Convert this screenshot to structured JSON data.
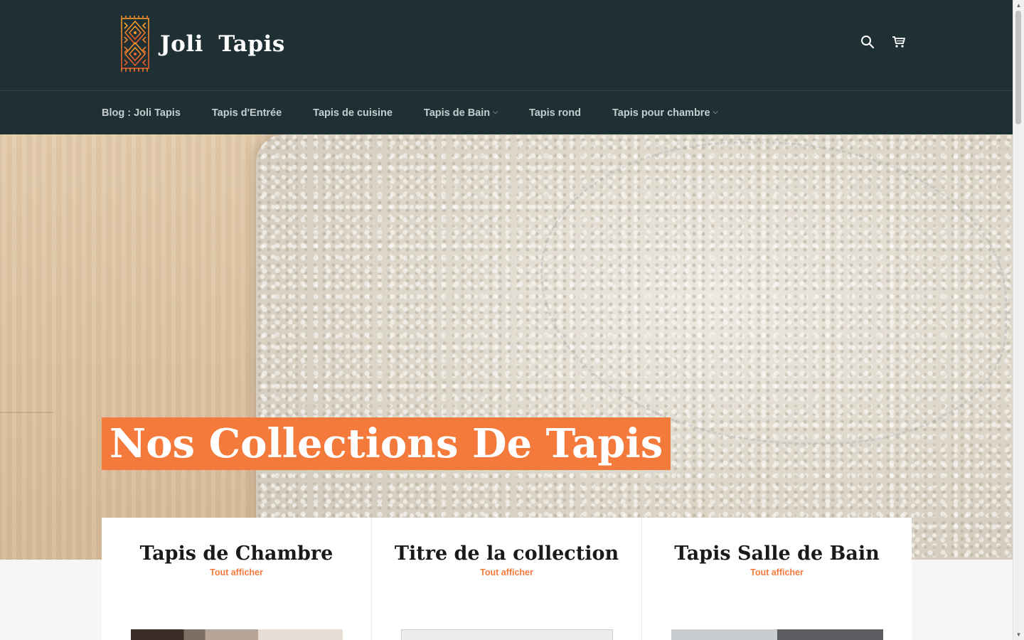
{
  "header": {
    "logo_text": "Joli  Tapis",
    "icons": [
      "search-icon",
      "cart-icon"
    ]
  },
  "nav": {
    "items": [
      {
        "label": "Blog : Joli Tapis",
        "dropdown": false
      },
      {
        "label": "Tapis d'Entrée",
        "dropdown": false
      },
      {
        "label": "Tapis de cuisine",
        "dropdown": false
      },
      {
        "label": "Tapis de Bain",
        "dropdown": true
      },
      {
        "label": "Tapis rond",
        "dropdown": false
      },
      {
        "label": "Tapis pour chambre",
        "dropdown": true
      }
    ]
  },
  "hero": {
    "title": "Nos Collections De Tapis"
  },
  "collections": [
    {
      "title": "Tapis de Chambre",
      "link": "Tout afficher"
    },
    {
      "title": "Titre de la collection",
      "link": "Tout afficher"
    },
    {
      "title": "Tapis Salle de Bain",
      "link": "Tout afficher"
    }
  ],
  "colors": {
    "header_bg": "#1f3035",
    "accent": "#f47a3c",
    "text_dark": "#1a1a1a"
  }
}
